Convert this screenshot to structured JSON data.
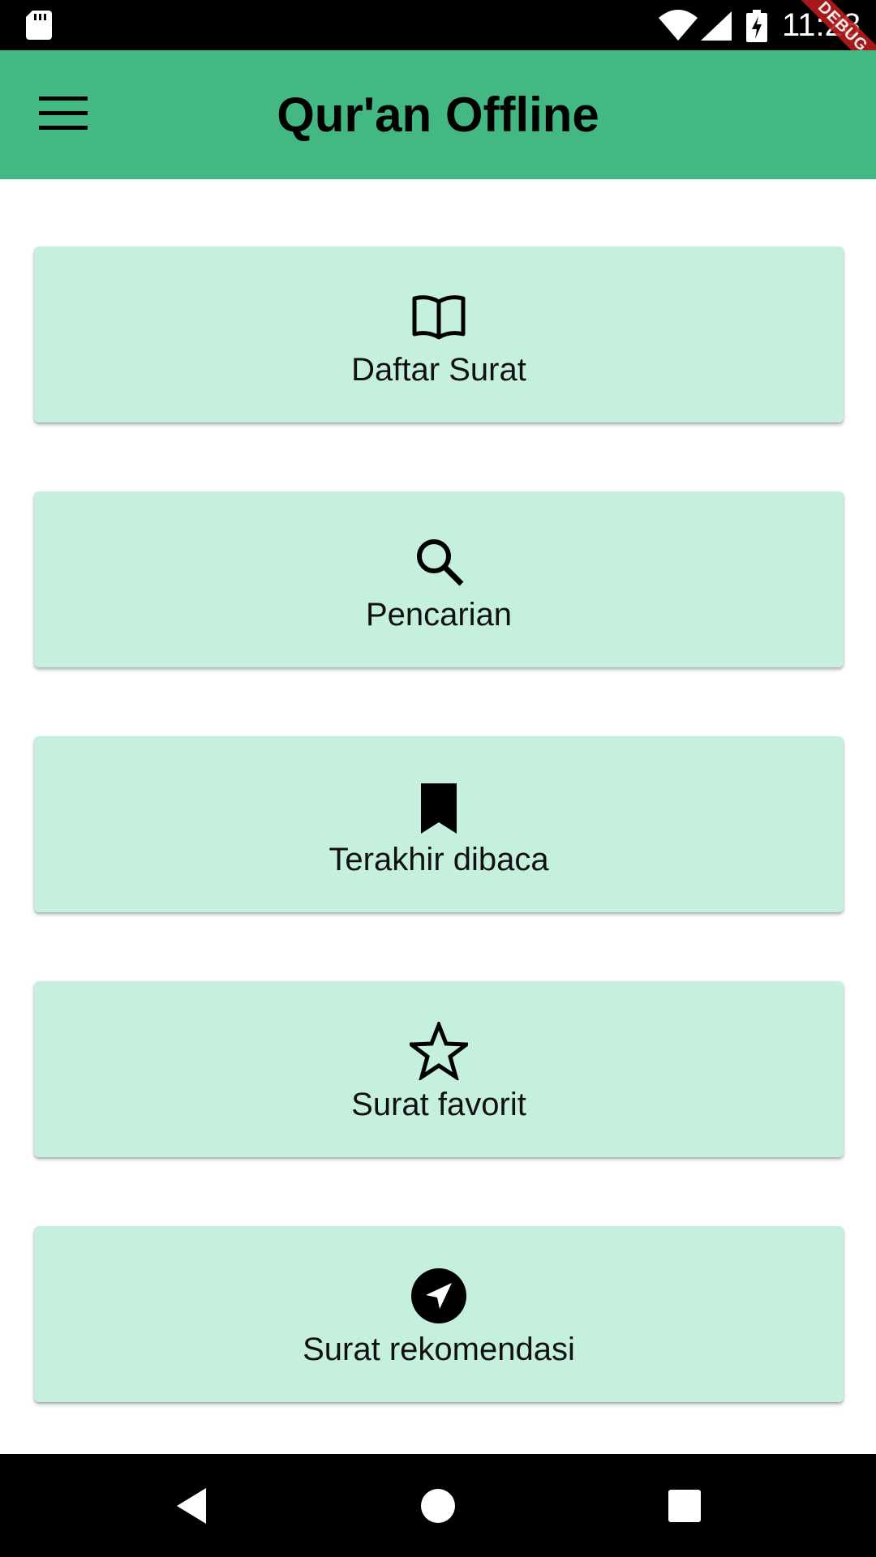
{
  "status_bar": {
    "time": "11:28",
    "icons": [
      "sd-card-icon",
      "wifi-icon",
      "signal-icon",
      "battery-charging-icon"
    ],
    "debug_banner": "DEBUG"
  },
  "app_bar": {
    "title": "Qur'an Offline",
    "menu_icon": "menu-icon",
    "color": "#43b883"
  },
  "menu_cards": [
    {
      "label": "Daftar Surat",
      "icon": "open-book-icon"
    },
    {
      "label": "Pencarian",
      "icon": "search-icon"
    },
    {
      "label": "Terakhir dibaca",
      "icon": "bookmark-icon"
    },
    {
      "label": "Surat favorit",
      "icon": "star-outline-icon"
    },
    {
      "label": "Surat rekomendasi",
      "icon": "navigation-icon"
    }
  ],
  "card_color": "#c5f0de",
  "nav_bar": {
    "icons": [
      "back-icon",
      "home-icon",
      "recents-icon"
    ]
  }
}
